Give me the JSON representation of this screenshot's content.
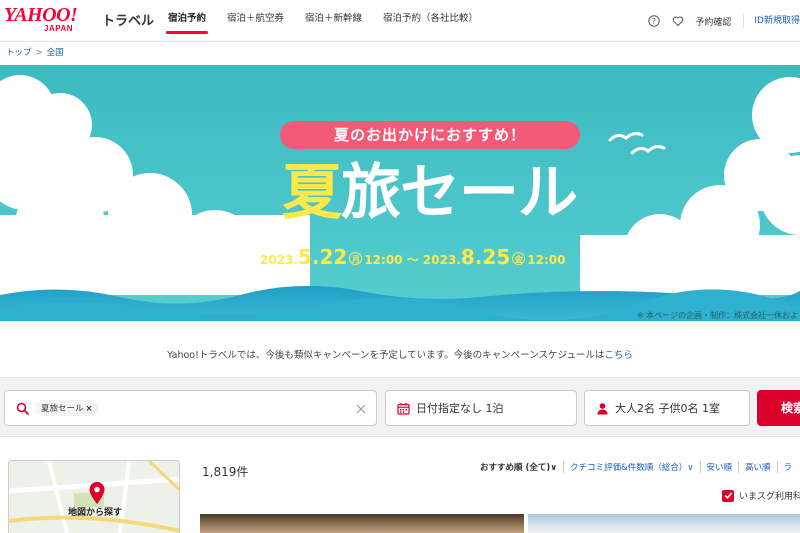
{
  "header": {
    "logo_yahoo": "YAHOO!",
    "logo_japan": "JAPAN",
    "logo_travel": "トラベル",
    "nav": [
      {
        "label": "宿泊予約",
        "active": true
      },
      {
        "label": "宿泊＋航空券",
        "active": false
      },
      {
        "label": "宿泊＋新幹線",
        "active": false
      },
      {
        "label": "宿泊予約（各社比較）",
        "active": false
      }
    ],
    "help_icon": "help-icon",
    "favorite_icon": "heart-icon",
    "reservation_label": "予約確認",
    "id_label": "ID新規取得"
  },
  "breadcrumb": {
    "top": "トップ",
    "separator": ">",
    "current": "全国"
  },
  "banner": {
    "pill_text": "夏のお出かけにおすすめ！",
    "title_first": "夏",
    "title_rest": "旅セール",
    "start_year": "2023.",
    "start_date": "5.22",
    "start_weekday": "月",
    "start_time": "12:00",
    "tilde": "〜",
    "end_year": "2023.",
    "end_date": "8.25",
    "end_weekday": "金",
    "end_time": "12:00",
    "note": "※ 本ページの企画・制作：株式会社一休およ",
    "colors": {
      "sky": "#45c3c8",
      "pill": "#f35a78",
      "accent_yellow": "#ffe94a"
    }
  },
  "info": {
    "text": "Yahoo!トラベルでは、今後も類似キャンペーンを予定しています。今後のキャンペーンスケジュールは",
    "link": "こちら"
  },
  "search": {
    "keyword_chip": "夏旅セール",
    "chip_remove": "×",
    "date_text": "日付指定なし 1泊",
    "guests_text": "大人2名 子供0名 1室",
    "search_button": "検索",
    "colors": {
      "brand_red": "#d9002b"
    }
  },
  "results": {
    "map_label": "地図から探す",
    "count": "1,819件",
    "sort_options": [
      "おすすめ順 (全て)∨",
      "クチコミ評価&件数順（総合）∨",
      "安い順",
      "高い順",
      "ラ"
    ],
    "now_usable_label": "いまスグ利用科",
    "now_usable_checked": true
  }
}
